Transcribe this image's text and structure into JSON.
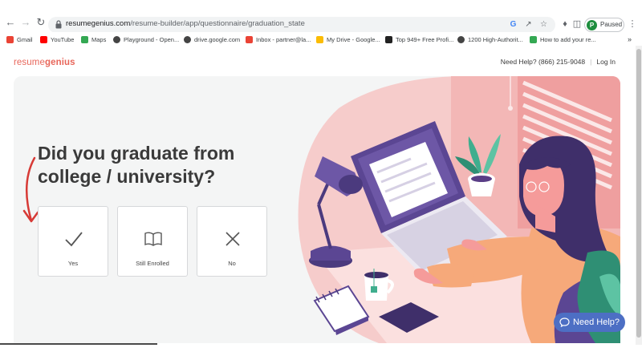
{
  "browser": {
    "url_host": "resumegenius.com",
    "url_path": "/resume-builder/app/questionnaire/graduation_state",
    "profile_initial": "P",
    "profile_status": "Paused",
    "bookmarks": [
      {
        "label": "Gmail",
        "color": "#ea4335"
      },
      {
        "label": "YouTube",
        "color": "#ff0000"
      },
      {
        "label": "Maps",
        "color": "#34a853"
      },
      {
        "label": "Playground - Open...",
        "color": "#202124"
      },
      {
        "label": "drive.google.com",
        "color": "#202124"
      },
      {
        "label": "Inbox - partner@la...",
        "color": "#ea4335"
      },
      {
        "label": "My Drive - Google...",
        "color": "#fbbc04"
      },
      {
        "label": "Top 949+ Free Profi...",
        "color": "#202124"
      },
      {
        "label": "1200 High-Authorit...",
        "color": "#202124"
      },
      {
        "label": "How to add your re...",
        "color": "#34a853"
      }
    ]
  },
  "header": {
    "logo_prefix": "resume",
    "logo_bold": "genius",
    "help_text": "Need Help? (866) 215-9048",
    "login_label": "Log In"
  },
  "question": {
    "title": "Did you graduate from college / university?"
  },
  "choices": [
    {
      "label": "Yes",
      "icon": "check-icon"
    },
    {
      "label": "Still Enrolled",
      "icon": "open-book-icon"
    },
    {
      "label": "No",
      "icon": "x-icon"
    }
  ],
  "chat": {
    "label": "Need Help?"
  },
  "colors": {
    "brand": "#e8665a",
    "chat": "#4d6fc4",
    "panel": "#f4f5f5"
  }
}
